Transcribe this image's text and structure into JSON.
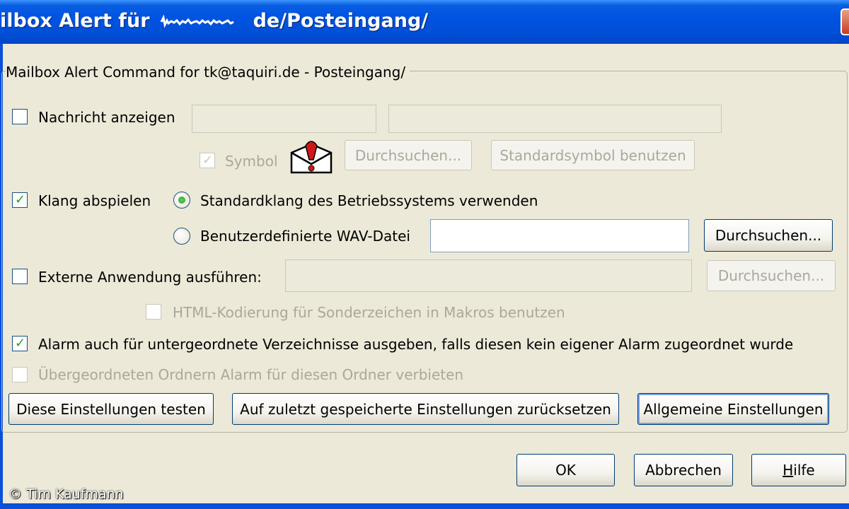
{
  "window": {
    "title_prefix": "ilbox Alert für",
    "title_suffix": "de/Posteingang/"
  },
  "group": {
    "legend": "Mailbox Alert Command for tk@taquiri.de - Posteingang/"
  },
  "message": {
    "label": "Nachricht anzeigen",
    "checked": false,
    "field1_value": "",
    "field2_value": "",
    "symbol_label": "Symbol",
    "symbol_checked": true,
    "browse_label": "Durchsuchen...",
    "default_symbol_label": "Standardsymbol benutzen"
  },
  "sound": {
    "label": "Klang abspielen",
    "checked": true,
    "option_system": "Standardklang des Betriebssystems verwenden",
    "option_custom": "Benutzerdefinierte WAV-Datei",
    "selected": "system",
    "wav_value": "",
    "browse_label": "Durchsuchen..."
  },
  "external": {
    "label": "Externe Anwendung ausführen:",
    "checked": false,
    "value": "",
    "browse_label": "Durchsuchen...",
    "html_encoding_label": "HTML-Kodierung für Sonderzeichen in Makros benutzen"
  },
  "subfolders": {
    "label": "Alarm auch für untergeordnete Verzeichnisse ausgeben, falls diesen kein eigener Alarm zugeordnet wurde",
    "checked": true
  },
  "parent": {
    "label": "Übergeordneten Ordnern Alarm für diesen Ordner verbieten",
    "checked": false
  },
  "actions": {
    "test": "Diese Einstellungen testen",
    "reset": "Auf zuletzt gespeicherte Einstellungen zurücksetzen",
    "general": "Allgemeine Einstellungen"
  },
  "footer": {
    "ok": "OK",
    "cancel": "Abbrechen",
    "help": "Hilfe",
    "help_mnemonic": "H",
    "help_rest": "ilfe"
  },
  "overlay": {
    "copyright": "© Tim Kaufmann"
  },
  "colors": {
    "titlebar": "#0054e3",
    "dialog_bg": "#ece9d8",
    "check_green": "#21a121",
    "disabled_text": "#aca899"
  },
  "icons": [
    "close-icon",
    "mail-alert-icon",
    "checkmark-icon",
    "radio-dot-icon"
  ]
}
